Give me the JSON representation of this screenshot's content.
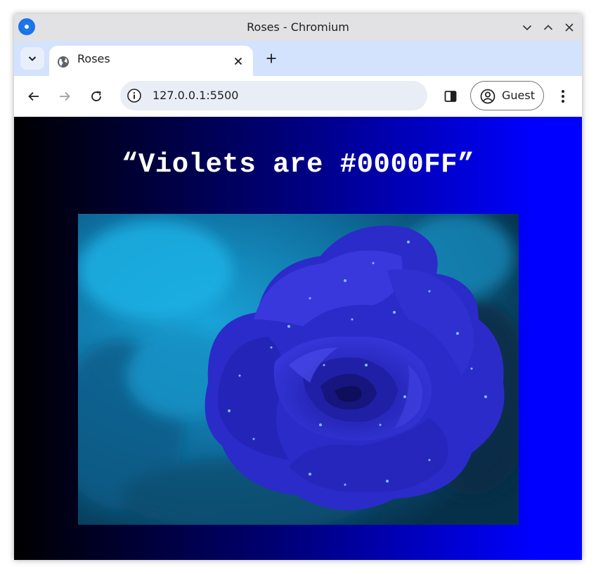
{
  "window": {
    "title": "Roses - Chromium"
  },
  "tabs": [
    {
      "label": "Roses",
      "active": true
    }
  ],
  "toolbar": {
    "url": "127.0.0.1:5500",
    "profile_label": "Guest"
  },
  "page": {
    "headline": "“Violets are #0000FF”",
    "image_alt": "Blue rose with water droplets",
    "gradient_colors": [
      "#000000",
      "#000070",
      "#0000ff"
    ]
  },
  "icons": {
    "app": "chromium-icon",
    "minimize": "chevron-down-icon",
    "maximize": "chevron-up-icon",
    "close": "close-icon",
    "tab_search": "tab-search-chevron-icon",
    "favicon": "globe-icon",
    "tab_close": "close-icon",
    "new_tab": "plus-icon",
    "back": "back-arrow-icon",
    "forward": "forward-arrow-icon",
    "reload": "reload-icon",
    "site_info": "info-icon",
    "side_panel": "side-panel-icon",
    "profile": "account-circle-icon",
    "menu": "kebab-menu-icon"
  }
}
